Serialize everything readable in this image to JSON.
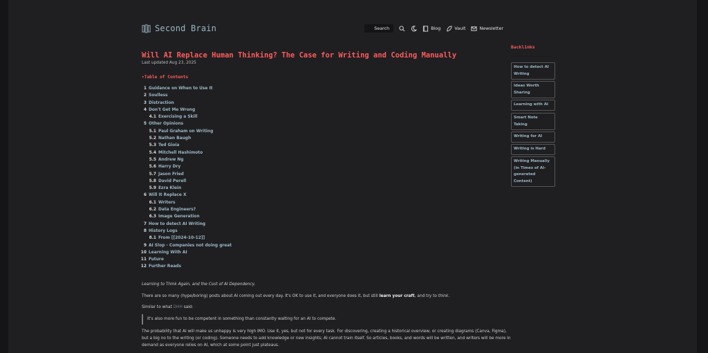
{
  "header": {
    "site_title": "Second Brain",
    "search_label": "Search",
    "nav": [
      {
        "label": "Blog",
        "icon": "book-icon"
      },
      {
        "label": "Vault",
        "icon": "leaf-icon"
      },
      {
        "label": "Newsletter",
        "icon": "mail-icon"
      }
    ]
  },
  "article": {
    "title": "Will AI Replace Human Thinking? The Case for Writing and Coding Manually",
    "last_updated": "Last updated Aug 23, 2025",
    "toc_heading": "Table of Contents",
    "toc": [
      {
        "num": "1",
        "label": "Guidance on When to Use It",
        "level": 1
      },
      {
        "num": "2",
        "label": "Soulless",
        "level": 1
      },
      {
        "num": "3",
        "label": "Distraction",
        "level": 1
      },
      {
        "num": "4",
        "label": "Don't Get Me Wrong",
        "level": 1
      },
      {
        "num": "4.1",
        "label": "Exercising a Skill",
        "level": 2
      },
      {
        "num": "5",
        "label": "Other Opinions",
        "level": 1
      },
      {
        "num": "5.1",
        "label": "Paul Graham on Writing",
        "level": 2
      },
      {
        "num": "5.2",
        "label": "Nathan Baugh",
        "level": 2
      },
      {
        "num": "5.3",
        "label": "Ted Gioia",
        "level": 2
      },
      {
        "num": "5.4",
        "label": "Mitchell Hashimoto",
        "level": 2
      },
      {
        "num": "5.5",
        "label": "Andrew Ng",
        "level": 2
      },
      {
        "num": "5.6",
        "label": "Harry Dry",
        "level": 2
      },
      {
        "num": "5.7",
        "label": "Jason Fried",
        "level": 2
      },
      {
        "num": "5.8",
        "label": "David Perell",
        "level": 2
      },
      {
        "num": "5.9",
        "label": "Ezra Klein",
        "level": 2
      },
      {
        "num": "6",
        "label": "Will It Replace X",
        "level": 1
      },
      {
        "num": "6.1",
        "label": "Writers",
        "level": 2
      },
      {
        "num": "6.2",
        "label": "Data Engineers?",
        "level": 2
      },
      {
        "num": "6.3",
        "label": "Image Generation",
        "level": 2
      },
      {
        "num": "7",
        "label": "How to detect AI Writing",
        "level": 1
      },
      {
        "num": "8",
        "label": "History Logs",
        "level": 1
      },
      {
        "num": "8.1",
        "label": "From [[2024-10-12]]",
        "level": 2
      },
      {
        "num": "9",
        "label": "AI Slop - Companies not doing great",
        "level": 1
      },
      {
        "num": "10",
        "label": "Learning With AI",
        "level": 1
      },
      {
        "num": "11",
        "label": "Future",
        "level": 1
      },
      {
        "num": "12",
        "label": "Further Reads",
        "level": 1
      }
    ],
    "lead": "Learning to Think Again, and the Cost of AI Dependency.",
    "intro_part1": "There are so many (hype/boring) posts about AI coming out every day. It's OK to use it, and everyone does it, but still ",
    "intro_bold": "learn your craft",
    "intro_part2": ", and try to ",
    "intro_italic": "think",
    "intro_end": ".",
    "similar_prefix": "Similar to what ",
    "similar_link": "DHH",
    "similar_suffix": " said:",
    "quote": "It's also more fun to be competent in something than constantly waiting for an AI to compete.",
    "probability": "The probability that AI will make us unhappy is very high IMO. Use it, yes, but not for every task. For discovering, creating a historical overview, or creating diagrams (Canva, Figma), but a big no to the writing (or coding). Someone needs to add knowledge or new insights; AI cannot train itself. So articles, books, and words will be written, and writers will be more in demand as everyone relies on AI, which at some point just plateaus."
  },
  "backlinks": {
    "heading": "Backlinks",
    "items": [
      "How to detect AI Writing",
      "Ideas Worth Sharing",
      "Learning with AI",
      "Smart Note Taking",
      "Writing for AI",
      "Writing is Hard",
      "Writing Manually (in Times of AI-generated Content)"
    ]
  },
  "colors": {
    "background": "#1f1f22",
    "accent_red": "#ff5b5b",
    "link_blue": "#9bb6c4"
  }
}
